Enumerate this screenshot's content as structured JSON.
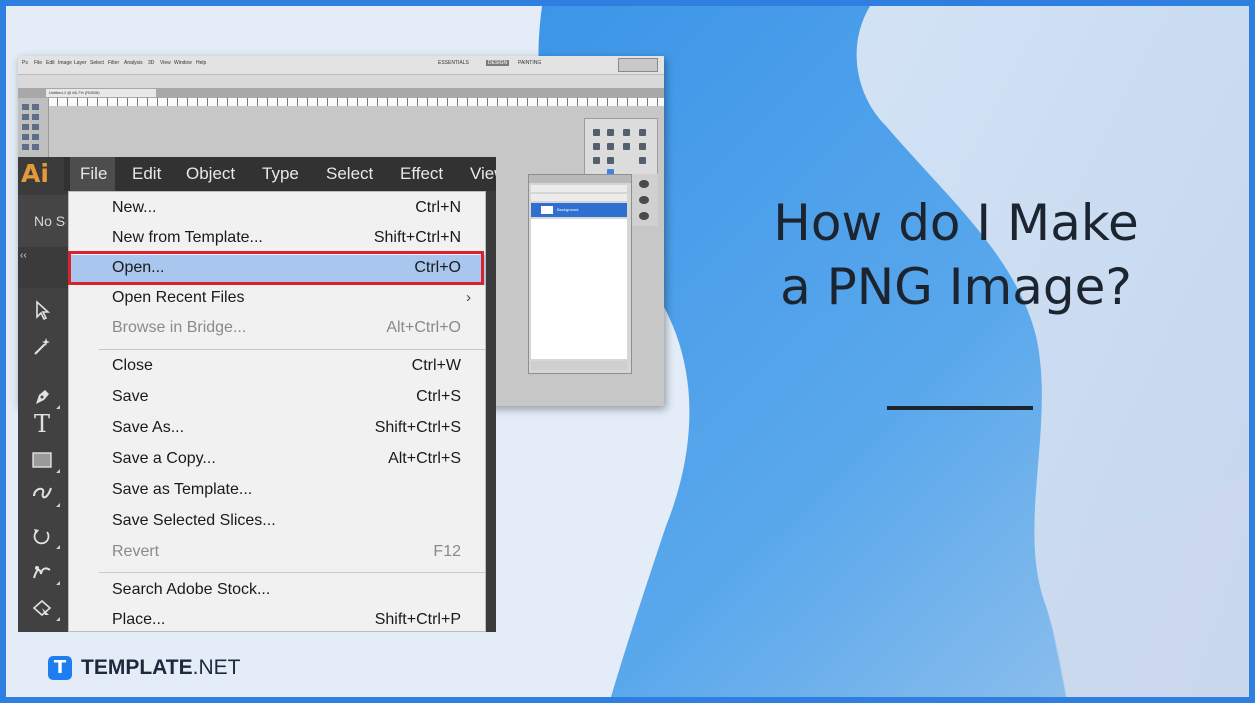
{
  "headline": {
    "line1": "How do I Make",
    "line2": "a PNG Image?"
  },
  "brand": {
    "icon_letter": "T",
    "name_bold": "TEMPLATE",
    "name_regular": ".NET",
    "color": "#1e7ef0"
  },
  "colors": {
    "frame": "#2f7fe0",
    "highlight": "#a8c6ee",
    "callout": "#d9222a",
    "ai_orange": "#e59a3a"
  },
  "ps_window": {
    "tab_title": "Untitled-1 @ 66.7% (RGB/8)",
    "menu": [
      "Ps",
      "File",
      "Edit",
      "Image",
      "Layer",
      "Select",
      "Filter",
      "Analysis",
      "3D",
      "View",
      "Window",
      "Help"
    ],
    "workspace_tabs": [
      "ESSENTIALS",
      "DESIGN",
      "PAINTING"
    ],
    "layers_row": "Background"
  },
  "illustrator": {
    "logo": "Ai",
    "menubar": [
      "File",
      "Edit",
      "Object",
      "Type",
      "Select",
      "Effect",
      "View"
    ],
    "control_label": "No Se",
    "collapse_glyph": "‹‹",
    "tools": [
      "selection-tool",
      "magic-wand-tool",
      "pen-tool",
      "type-tool",
      "rectangle-tool",
      "shaper-tool",
      "rotate-tool",
      "puppet-warp-tool",
      "perspective-tool"
    ],
    "type_tool_glyph": "T"
  },
  "file_menu": {
    "items": [
      {
        "label": "New...",
        "shortcut": "Ctrl+N",
        "disabled": false
      },
      {
        "label": "New from Template...",
        "shortcut": "Shift+Ctrl+N",
        "disabled": false
      },
      {
        "label": "Open...",
        "shortcut": "Ctrl+O",
        "disabled": false,
        "highlighted": true
      },
      {
        "label": "Open Recent Files",
        "shortcut": "",
        "submenu": true,
        "submenu_glyph": "›"
      },
      {
        "label": "Browse in Bridge...",
        "shortcut": "Alt+Ctrl+O",
        "disabled": true
      },
      {
        "label": "Close",
        "shortcut": "Ctrl+W",
        "disabled": false
      },
      {
        "label": "Save",
        "shortcut": "Ctrl+S",
        "disabled": false
      },
      {
        "label": "Save As...",
        "shortcut": "Shift+Ctrl+S",
        "disabled": false
      },
      {
        "label": "Save a Copy...",
        "shortcut": "Alt+Ctrl+S",
        "disabled": false
      },
      {
        "label": "Save as Template...",
        "shortcut": "",
        "disabled": false
      },
      {
        "label": "Save Selected Slices...",
        "shortcut": "",
        "disabled": false
      },
      {
        "label": "Revert",
        "shortcut": "F12",
        "disabled": true
      },
      {
        "label": "Search Adobe Stock...",
        "shortcut": "",
        "disabled": false
      },
      {
        "label": "Place...",
        "shortcut": "Shift+Ctrl+P",
        "disabled": false
      }
    ]
  }
}
